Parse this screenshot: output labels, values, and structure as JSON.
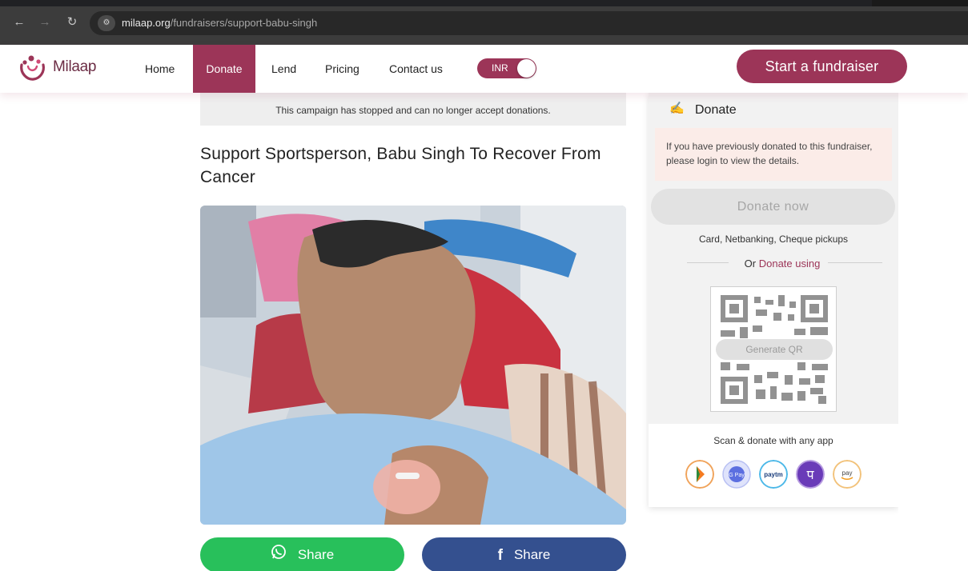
{
  "browser": {
    "url_domain": "milaap.org",
    "url_path": "/fundraisers/support-babu-singh"
  },
  "header": {
    "logo_text": "Milaap",
    "nav": {
      "home": "Home",
      "donate": "Donate",
      "lend": "Lend",
      "pricing": "Pricing",
      "contact": "Contact us"
    },
    "currency": "INR",
    "start_button": "Start a fundraiser"
  },
  "campaign": {
    "stopped_notice": "This campaign has stopped and can no longer accept donations.",
    "title": "Support Sportsperson, Babu Singh To Recover From Cancer"
  },
  "share": {
    "whatsapp_label": "Share",
    "facebook_label": "Share"
  },
  "donate_panel": {
    "title": "Donate",
    "login_note": "If you have previously donated to this fundraiser, please login to view the details.",
    "donate_now": "Donate now",
    "payment_methods": "Card, Netbanking, Cheque pickups",
    "or_prefix": "Or",
    "or_link": "Donate using",
    "generate_qr": "Generate QR",
    "scan_label": "Scan & donate with any app",
    "apps": [
      "bhim-icon",
      "gpay-icon",
      "paytm-icon",
      "phonepe-icon",
      "amazon-pay-icon"
    ]
  },
  "colors": {
    "brand": "#9c3558",
    "whatsapp": "#28c05b",
    "facebook": "#34508f"
  }
}
